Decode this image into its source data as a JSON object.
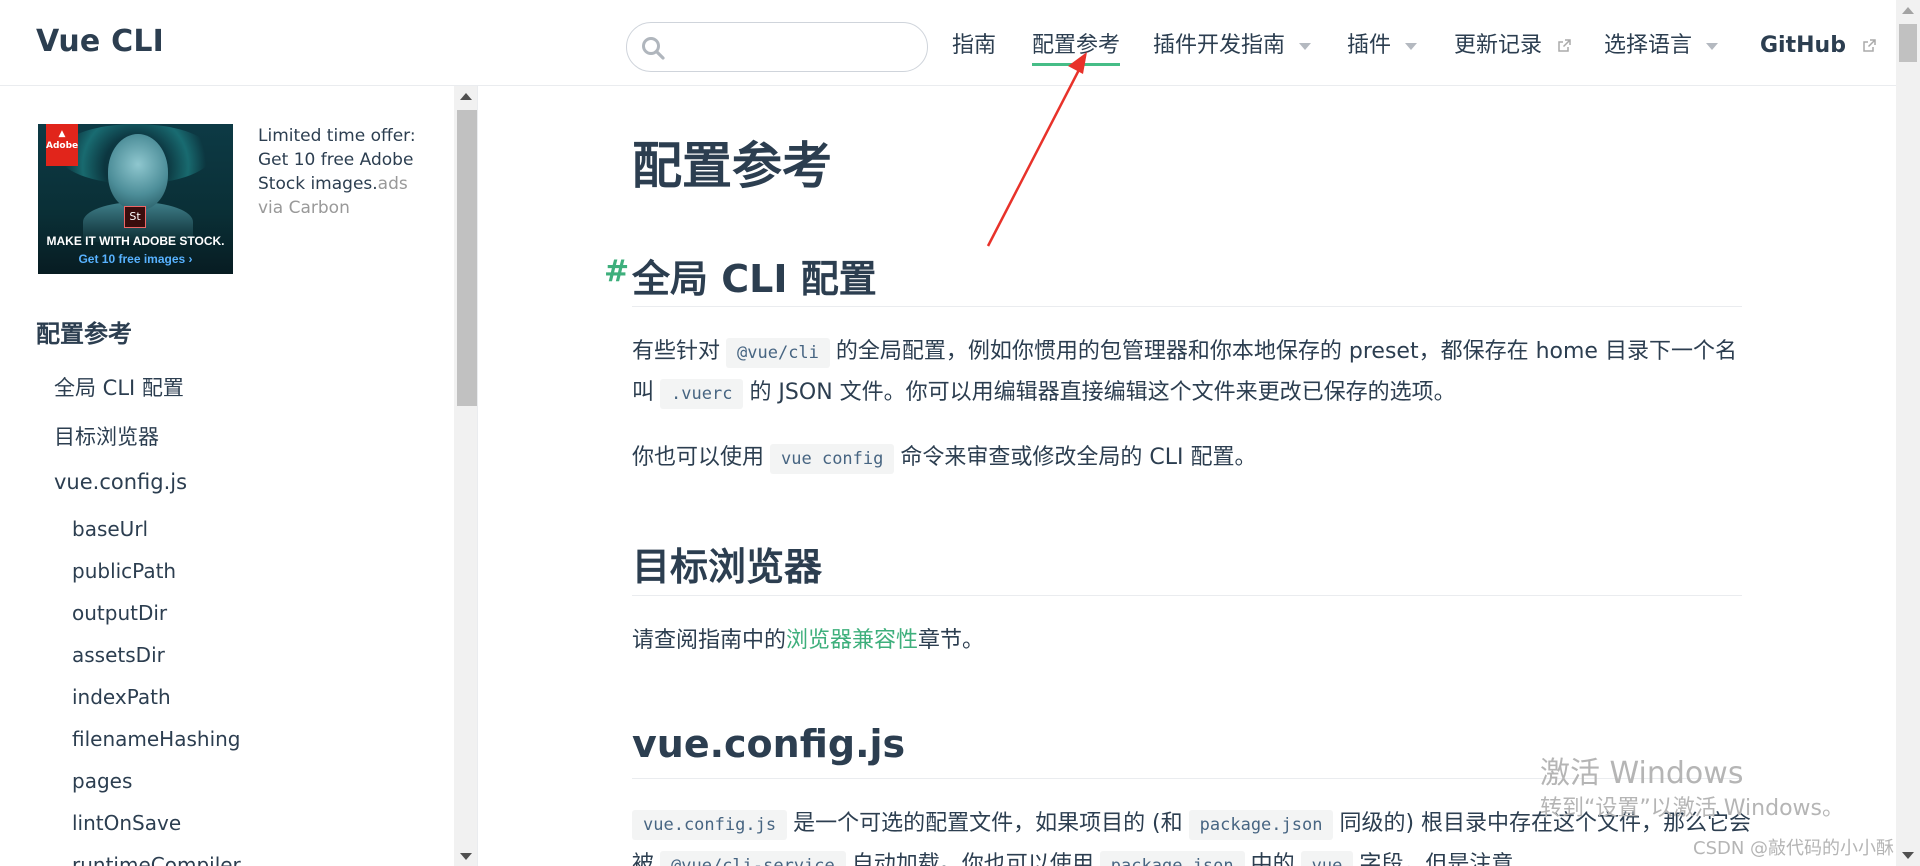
{
  "site": {
    "name": "Vue CLI"
  },
  "search": {
    "placeholder": "",
    "value": ""
  },
  "nav": [
    {
      "label": "指南",
      "dropdown": false,
      "external": false,
      "active": false
    },
    {
      "label": "配置参考",
      "dropdown": false,
      "external": false,
      "active": true
    },
    {
      "label": "插件开发指南",
      "dropdown": true,
      "external": false,
      "active": false
    },
    {
      "label": "插件",
      "dropdown": true,
      "external": false,
      "active": false
    },
    {
      "label": "更新记录",
      "dropdown": false,
      "external": true,
      "active": false
    },
    {
      "label": "选择语言",
      "dropdown": true,
      "external": false,
      "active": false
    },
    {
      "label": "GitHub",
      "dropdown": false,
      "external": true,
      "active": false
    }
  ],
  "ad": {
    "image_tag_line1": "MAKE IT WITH ADOBE STOCK.",
    "image_tag_line2": "Get 10 free images ›",
    "image_brand": "Adobe",
    "image_st": "St",
    "text_line1": "Limited time offer:",
    "text_line2": "Get 10 free Adobe",
    "text_line3": "Stock images.",
    "text_ads": "ads",
    "text_via": "via Carbon"
  },
  "sidebar": {
    "heading": "配置参考",
    "items": [
      {
        "label": "全局 CLI 配置",
        "level": 1
      },
      {
        "label": "目标浏览器",
        "level": 1
      },
      {
        "label": "vue.config.js",
        "level": 1
      },
      {
        "label": "baseUrl",
        "level": 2
      },
      {
        "label": "publicPath",
        "level": 2
      },
      {
        "label": "outputDir",
        "level": 2
      },
      {
        "label": "assetsDir",
        "level": 2
      },
      {
        "label": "indexPath",
        "level": 2
      },
      {
        "label": "filenameHashing",
        "level": 2
      },
      {
        "label": "pages",
        "level": 2
      },
      {
        "label": "lintOnSave",
        "level": 2
      },
      {
        "label": "runtimeCompiler",
        "level": 2
      }
    ]
  },
  "content": {
    "title": "配置参考",
    "anchor": "#",
    "sections": {
      "global": {
        "heading": "全局 CLI 配置",
        "p1_a": "有些针对",
        "p1_code": "@vue/cli",
        "p1_b": "的全局配置，例如你惯用的包管理器和你本地保存的 preset，都保存在 home 目录下一个名叫",
        "p1_code2": ".vuerc",
        "p1_c": "的 JSON 文件。你可以用编辑器直接编辑这个文件来更改已保存的选项。",
        "p2_a": "你也可以使用",
        "p2_code": "vue config",
        "p2_b": "命令来审查或修改全局的 CLI 配置。"
      },
      "browsers": {
        "heading": "目标浏览器",
        "p_a": "请查阅指南中的",
        "p_link": "浏览器兼容性",
        "p_b": "章节。"
      },
      "vueconfig": {
        "heading": "vue.config.js",
        "p_code1": "vue.config.js",
        "p_a": "是一个可选的配置文件，如果项目的 (和",
        "p_code2": "package.json",
        "p_b": "同级的) 根目录中存在这个文件，那么它会被",
        "p_code3": "@vue/cli-service",
        "p_c": "自动加载。你也可以使用",
        "p_code4": "package.json",
        "p_d": "中的",
        "p_code5": "vue",
        "p_e": "字段，但是注意"
      }
    }
  },
  "watermark": {
    "line1": "激活 Windows",
    "line2": "转到“设置”以激活 Windows。",
    "credit": "CSDN @敲代码的小小酥"
  },
  "colors": {
    "accent": "#3eaf7c",
    "text": "#2c3e50",
    "annotation": "#e8322a"
  }
}
